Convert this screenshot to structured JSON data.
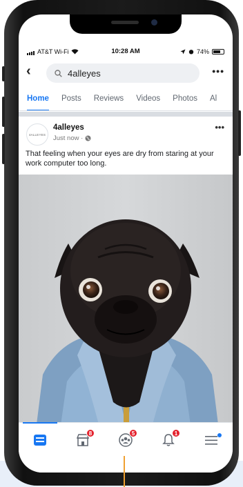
{
  "status_bar": {
    "carrier": "AT&T Wi-Fi",
    "time": "10:28 AM",
    "battery": "74%"
  },
  "search": {
    "query": "4alleyes"
  },
  "tabs": [
    {
      "label": "Home",
      "active": true
    },
    {
      "label": "Posts",
      "active": false
    },
    {
      "label": "Reviews",
      "active": false
    },
    {
      "label": "Videos",
      "active": false
    },
    {
      "label": "Photos",
      "active": false
    },
    {
      "label": "Al",
      "active": false
    }
  ],
  "post": {
    "avatar_text": "4ALLEYES",
    "page_name": "4alleyes",
    "time": "Just now ·",
    "text": "That feeling when your eyes are dry from staring at your work computer too long."
  },
  "tabbar": {
    "marketplace_badge": "8",
    "groups_badge": "5",
    "notifications_badge": "1"
  },
  "colors": {
    "accent": "#1877f2",
    "badge": "#e4212c",
    "pointer_line": "#f0a030"
  }
}
